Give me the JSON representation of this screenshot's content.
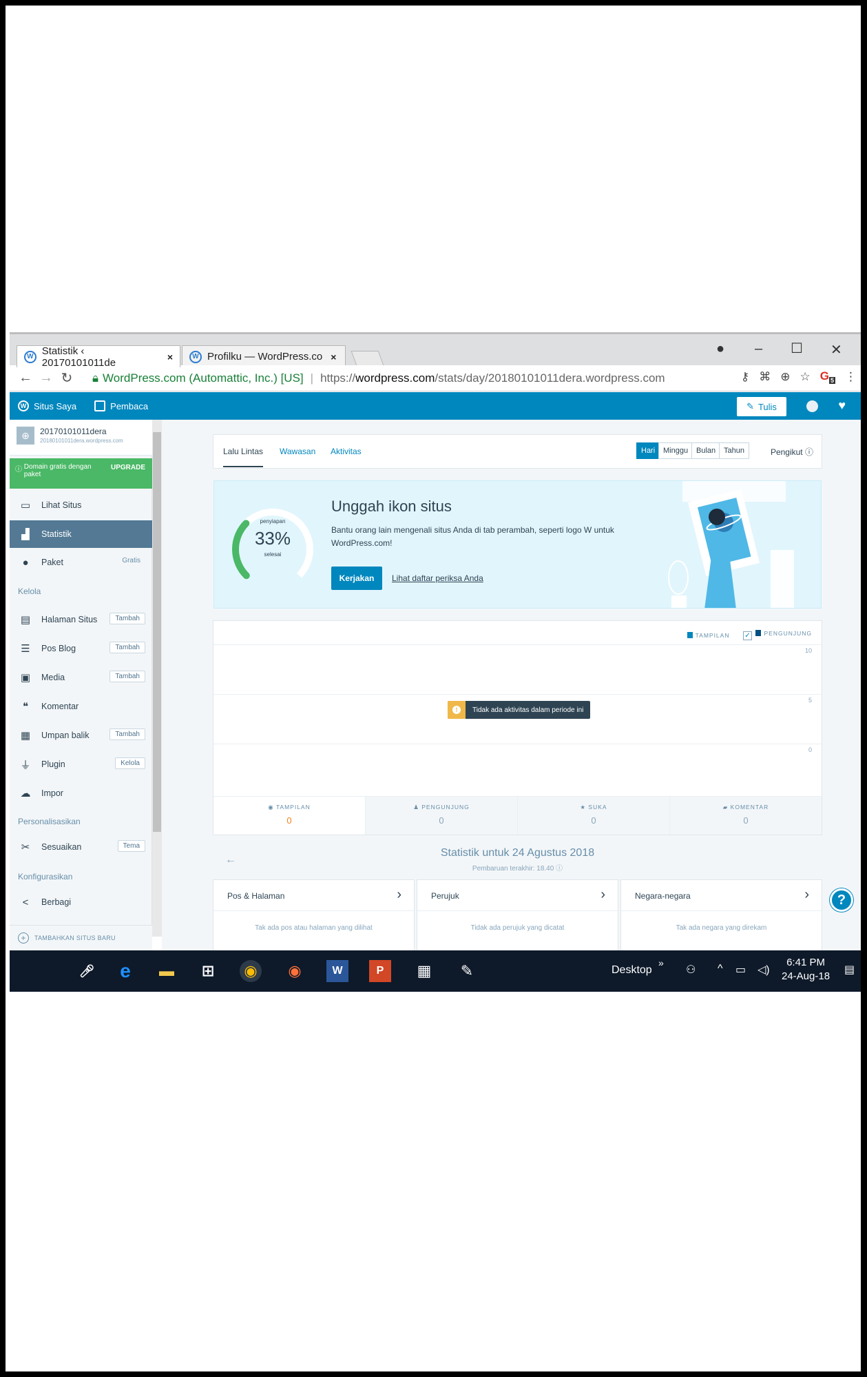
{
  "browser": {
    "tabs": [
      {
        "title": "Statistik ‹ 20170101011de",
        "close": "×"
      },
      {
        "title": "Profilku — WordPress.co",
        "close": "×"
      }
    ],
    "url_org": "WordPress.com (Automattic, Inc.) [US]",
    "url_scheme": "https://",
    "url_host": "wordpress.com",
    "url_path": "/stats/day/20180101011dera.wordpress.com",
    "profile_badge": "5"
  },
  "masterbar": {
    "my_sites": "Situs Saya",
    "reader": "Pembaca",
    "write": "Tulis"
  },
  "sidebar": {
    "site_name": "20170101011dera",
    "site_url": "20180101011dera.wordpress.com",
    "upgrade_text": "Domain gratis dengan paket",
    "upgrade_cta": "UPGRADE",
    "items": [
      {
        "label": "Lihat Situs",
        "icon": "monitor-icon"
      },
      {
        "label": "Statistik",
        "icon": "bar-chart-icon"
      },
      {
        "label": "Paket",
        "icon": "plan-icon",
        "tag": "Gratis"
      }
    ],
    "section_manage": "Kelola",
    "manage_items": [
      {
        "label": "Halaman Situs",
        "tag": "Tambah"
      },
      {
        "label": "Pos Blog",
        "tag": "Tambah"
      },
      {
        "label": "Media",
        "tag": "Tambah"
      },
      {
        "label": "Komentar"
      },
      {
        "label": "Umpan balik",
        "tag": "Tambah"
      },
      {
        "label": "Plugin",
        "tag": "Kelola"
      },
      {
        "label": "Impor"
      }
    ],
    "section_personalize": "Personalisasikan",
    "customize": {
      "label": "Sesuaikan",
      "tag": "Tema"
    },
    "section_config": "Konfigurasikan",
    "share": {
      "label": "Berbagi"
    },
    "add_site": "TAMBAHKAN SITUS BARU"
  },
  "stats_nav": {
    "tabs": [
      "Lalu Lintas",
      "Wawasan",
      "Aktivitas"
    ],
    "periods": [
      "Hari",
      "Minggu",
      "Bulan",
      "Tahun"
    ],
    "active_period": "Hari",
    "followers": "Pengikut"
  },
  "checklist": {
    "progress_label_top": "penyiapan",
    "progress_percent": "33%",
    "progress_fraction": 0.33,
    "progress_label_bottom": "selesai",
    "title": "Unggah ikon situs",
    "description": "Bantu orang lain mengenali situs Anda di tab perambah, seperti logo W untuk WordPress.com!",
    "action": "Kerjakan",
    "link": "Lihat daftar periksa Anda"
  },
  "chart": {
    "legend_views": "TAMPILAN",
    "legend_visitors": "PENGUNJUNG",
    "y_ticks": [
      "10",
      "5",
      "0"
    ],
    "empty_notice": "Tidak ada aktivitas dalam periode ini",
    "summary": [
      {
        "label": "TAMPILAN",
        "value": "0",
        "icon": "eye-icon"
      },
      {
        "label": "PENGUNJUNG",
        "value": "0",
        "icon": "person-icon"
      },
      {
        "label": "SUKA",
        "value": "0",
        "icon": "star-icon"
      },
      {
        "label": "KOMENTAR",
        "value": "0",
        "icon": "comment-icon"
      }
    ]
  },
  "stats_for": {
    "title": "Statistik untuk 24 Agustus 2018",
    "subtitle": "Pembaruan terakhir: 18.40"
  },
  "modules": [
    {
      "title": "Pos & Halaman",
      "empty": "Tak ada pos atau halaman yang dilihat"
    },
    {
      "title": "Perujuk",
      "empty": "Tidak ada perujuk yang dicatat"
    },
    {
      "title": "Negara-negara",
      "empty": "Tak ada negara yang direkam"
    }
  ],
  "taskbar": {
    "desktop": "Desktop",
    "time": "6:41 PM",
    "date": "24-Aug-18"
  }
}
